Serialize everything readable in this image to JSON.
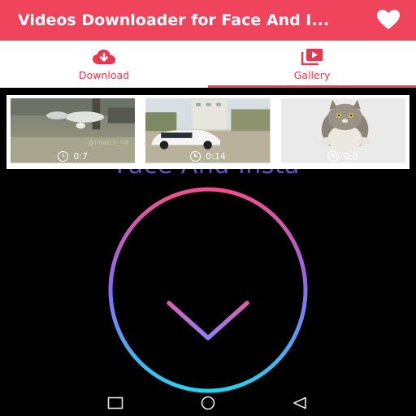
{
  "app_bar": {
    "title": "Videos Downloader for Face And I...",
    "background": "#f0435c",
    "favorite_icon": "heart-icon"
  },
  "tabs": [
    {
      "label": "Download",
      "icon": "cloud-download-icon",
      "active": false
    },
    {
      "label": "Gallery",
      "icon": "video-library-icon",
      "active": true
    }
  ],
  "gallery": {
    "items": [
      {
        "duration": "0:7",
        "watermark": "@imatch_hit"
      },
      {
        "duration": "0:14"
      },
      {
        "duration": "0:8"
      }
    ]
  },
  "background_title": "Face And Insta",
  "colors": {
    "accent": "#f0435c",
    "tab_text": "#e63950",
    "gradient_top": "#f0508a",
    "gradient_mid": "#8a6cf0",
    "gradient_bottom": "#2ad0f0"
  },
  "nav_bar": {
    "buttons": [
      "recent-apps-icon",
      "home-icon",
      "back-icon"
    ]
  }
}
